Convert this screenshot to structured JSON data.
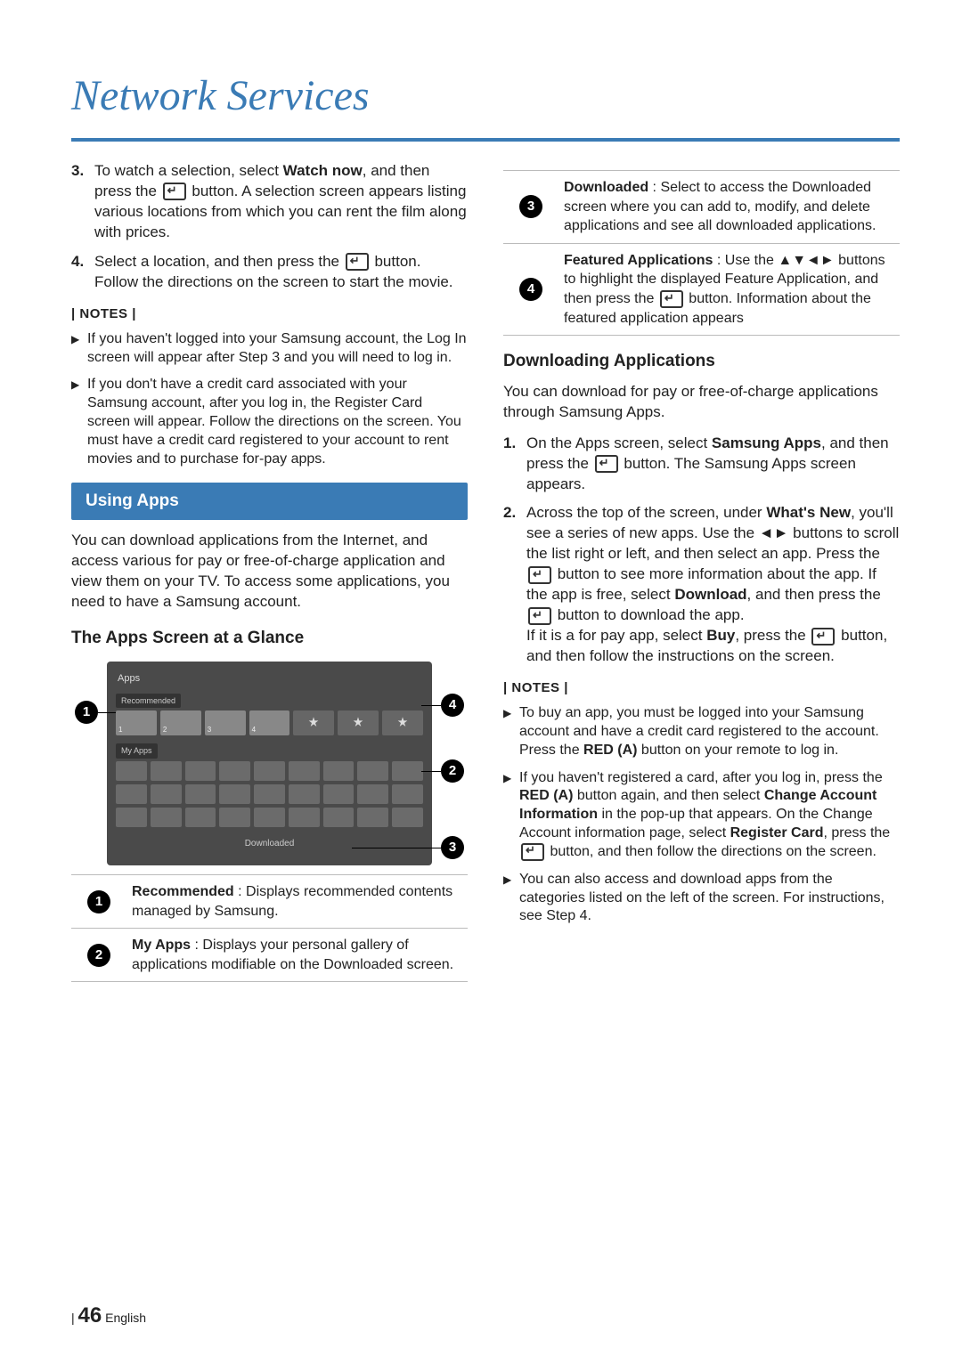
{
  "header": {
    "title": "Network Services"
  },
  "left": {
    "step3_pre": "To watch a selection, select ",
    "step3_bold": "Watch now",
    "step3_post1": ", and then press the ",
    "step3_post2": " button. A selection screen appears listing various locations from which you can rent the film along with prices.",
    "step4_pre": "Select a location, and then press the ",
    "step4_post": " button. Follow the directions on the screen to start the movie.",
    "notes_label": "| NOTES |",
    "note1": "If you haven't logged into your Samsung account, the Log In screen will appear after Step 3 and you will need to log in.",
    "note2": "If you don't have a credit card associated with your Samsung account, after you log in, the Register Card screen will appear. Follow the directions on the screen. You must have a credit card registered to your account to rent movies and to purchase for-pay apps.",
    "using_apps": "Using Apps",
    "using_body": "You can download applications from the Internet, and access various for pay or free-of-charge application and view them on your TV. To access some applications, you need to have a Samsung account.",
    "glance": "The Apps Screen at a Glance",
    "screen_labels": {
      "apps": "Apps",
      "recommended": "Recommended",
      "myapps": "My Apps",
      "downloaded": "Downloaded"
    },
    "callouts": {
      "c1": {
        "label": "Recommended",
        "body": " : Displays recommended contents managed by Samsung."
      },
      "c2": {
        "label": "My Apps",
        "body": " : Displays your personal gallery of applications modifiable on the Downloaded screen."
      }
    }
  },
  "right": {
    "callouts": {
      "c3": {
        "label": "Downloaded",
        "body": " : Select to access the Downloaded screen where you can add to, modify, and delete applications and see all downloaded applications."
      },
      "c4": {
        "label": "Featured Applications",
        "body_pre": " : Use the ▲▼◄► buttons to highlight the displayed Feature Application, and then press the ",
        "body_post": " button. Information about the featured application appears"
      }
    },
    "dl_heading": "Downloading Applications",
    "dl_intro": "You can download for pay or free-of-charge applications through Samsung Apps.",
    "s1_pre": "On the Apps screen, select ",
    "s1_b": "Samsung Apps",
    "s1_mid": ", and then press the ",
    "s1_post": " button. The Samsung Apps screen appears.",
    "s2_a": "Across the top of the screen, under ",
    "s2_b1": "What's New",
    "s2_c": ", you'll see a series of new apps. Use the ◄► buttons to scroll the list right or left, and then select an app. Press the ",
    "s2_d": " button to see more information about the app. If the app is free, select ",
    "s2_b2": "Download",
    "s2_e": ", and then press the ",
    "s2_f": " button to download the app.",
    "s2_g": "If it is a for pay app, select ",
    "s2_b3": "Buy",
    "s2_h": ", press the ",
    "s2_i": " button, and then follow the instructions on the screen.",
    "notes_label": "| NOTES |",
    "rn1_a": "To buy an app, you must be logged into your Samsung account and have a credit card registered to the account. Press the ",
    "rn1_b": "RED (A)",
    "rn1_c": " button on your remote to log in.",
    "rn2_a": "If you haven't registered a card, after you log in, press the ",
    "rn2_b1": "RED (A)",
    "rn2_c": " button again, and then select ",
    "rn2_b2": "Change Account Information",
    "rn2_d": " in the pop-up that appears. On the Change Account information page, select ",
    "rn2_b3": "Register Card",
    "rn2_e": ", press the ",
    "rn2_f": " button, and then follow the directions on the screen.",
    "rn3": "You can also access and download apps from the categories listed on the left of the screen. For instructions, see Step 4."
  },
  "footer": {
    "page": "46",
    "lang": "English"
  }
}
